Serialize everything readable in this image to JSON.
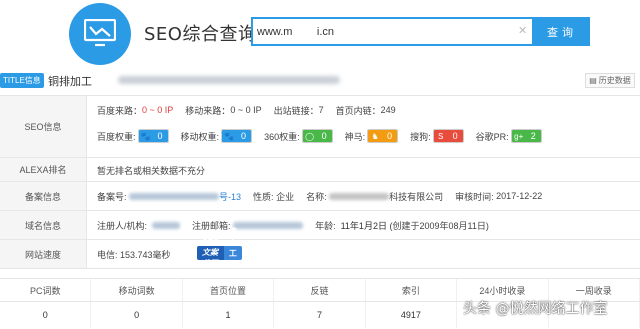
{
  "header": {
    "brand": "SEO综合查询",
    "search_value": "www.m        i.cn",
    "search_button": "查询"
  },
  "title_row": {
    "tag": "TITLE信息",
    "title": "铜排加工",
    "history": "历史数据"
  },
  "seo": {
    "label": "SEO信息",
    "line1": [
      {
        "label": "百度来路：",
        "value": "0 ~ 0 IP",
        "red": true
      },
      {
        "label": "移动来路：",
        "value": "0 ~ 0 IP",
        "red": false
      },
      {
        "label": "出站链接：",
        "value": "7",
        "red": false
      },
      {
        "label": "首页内链：",
        "value": "249",
        "red": false
      }
    ],
    "weights": [
      {
        "label": "百度权重:",
        "value": "0",
        "color": "#2b9be6",
        "icon": "paw-icon"
      },
      {
        "label": "移动权重:",
        "value": "0",
        "color": "#2b9be6",
        "icon": "paw-icon"
      },
      {
        "label": "360权重:",
        "value": "0",
        "color": "#49b849",
        "icon": "360-icon"
      },
      {
        "label": "神马:",
        "value": "0",
        "color": "#f39c12",
        "icon": "horse-icon"
      },
      {
        "label": "搜狗:",
        "value": "0",
        "color": "#e74c3c",
        "icon": "sogou-icon"
      },
      {
        "label": "谷歌PR:",
        "value": "2",
        "color": "#49b849",
        "icon": "google-plus-icon"
      }
    ]
  },
  "alexa": {
    "label": "ALEXA排名",
    "value": "暂无排名或相关数据不充分"
  },
  "beian": {
    "label": "备案信息",
    "number_label": "备案号:",
    "number_suffix": "号-13",
    "nature_label": "性质:",
    "nature": "企业",
    "name_label": "名称:",
    "name_suffix": "科技有限公司",
    "audit_label": "审核时间:",
    "audit_time": "2017-12-22"
  },
  "domain": {
    "label": "域名信息",
    "registrant_label": "注册人/机构:",
    "email_label": "注册邮箱:",
    "age_label": "年龄:",
    "age": "11年1月2日",
    "created": "(创建于2009年08月11日)"
  },
  "speed": {
    "label": "网站速度",
    "value": "电信: 153.743毫秒",
    "promo_left": "SEO文案代写",
    "promo_right": "纯人工编辑"
  },
  "stats": {
    "headers": [
      "PC词数",
      "移动词数",
      "首页位置",
      "反链",
      "索引",
      "24小时收录",
      "一周收录"
    ],
    "values": [
      "0",
      "0",
      "1",
      "7",
      "4917",
      "",
      ""
    ]
  },
  "watermark": "头条 @悦然网络工作室"
}
